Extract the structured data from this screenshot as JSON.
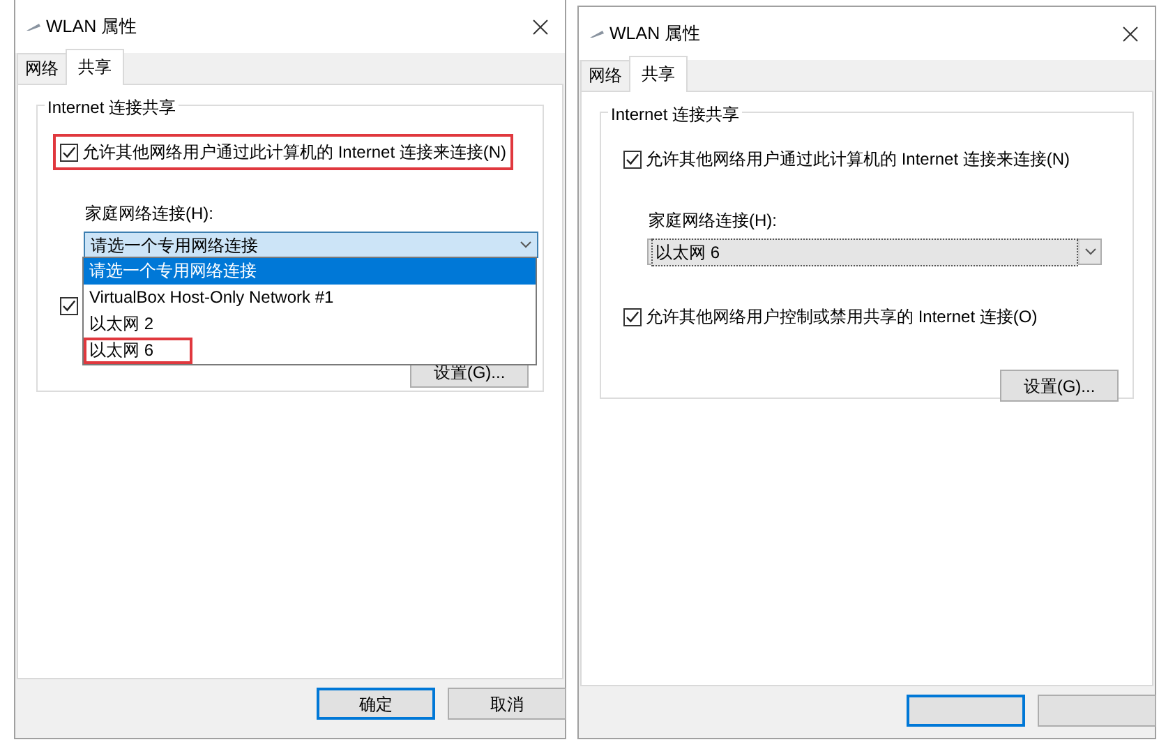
{
  "dialogs": [
    {
      "title": "WLAN 属性",
      "tabs": [
        {
          "label": "网络",
          "selected": false
        },
        {
          "label": "共享",
          "selected": true
        }
      ],
      "group_title": "Internet 连接共享",
      "allow_sharing": {
        "label": "允许其他网络用户通过此计算机的 Internet 连接来连接(N)",
        "checked": true,
        "highlighted": true
      },
      "home_network": {
        "label": "家庭网络连接(H):",
        "value": "请选一个专用网络连接",
        "focused": true,
        "expanded": true,
        "options": [
          {
            "label": "请选一个专用网络连接",
            "selected": true,
            "highlighted": false
          },
          {
            "label": "VirtualBox Host-Only Network #1",
            "selected": false,
            "highlighted": false
          },
          {
            "label": "以太网 2",
            "selected": false,
            "highlighted": false
          },
          {
            "label": "以太网 6",
            "selected": false,
            "highlighted": true
          }
        ]
      },
      "allow_control": {
        "checked": true
      },
      "settings_button": "设置(G)...",
      "buttons": [
        {
          "label": "确定",
          "default": true
        },
        {
          "label": "取消",
          "default": false
        }
      ]
    },
    {
      "title": "WLAN 属性",
      "tabs": [
        {
          "label": "网络",
          "selected": false
        },
        {
          "label": "共享",
          "selected": true
        }
      ],
      "group_title": "Internet 连接共享",
      "allow_sharing": {
        "label": "允许其他网络用户通过此计算机的 Internet 连接来连接(N)",
        "checked": true,
        "highlighted": false
      },
      "home_network": {
        "label": "家庭网络连接(H):",
        "value": "以太网 6",
        "focused": false,
        "expanded": false
      },
      "allow_control": {
        "label": "允许其他网络用户控制或禁用共享的 Internet 连接(O)",
        "checked": true
      },
      "settings_button": "设置(G)...",
      "buttons": [
        {
          "default": true
        },
        {
          "default": false
        }
      ]
    }
  ]
}
